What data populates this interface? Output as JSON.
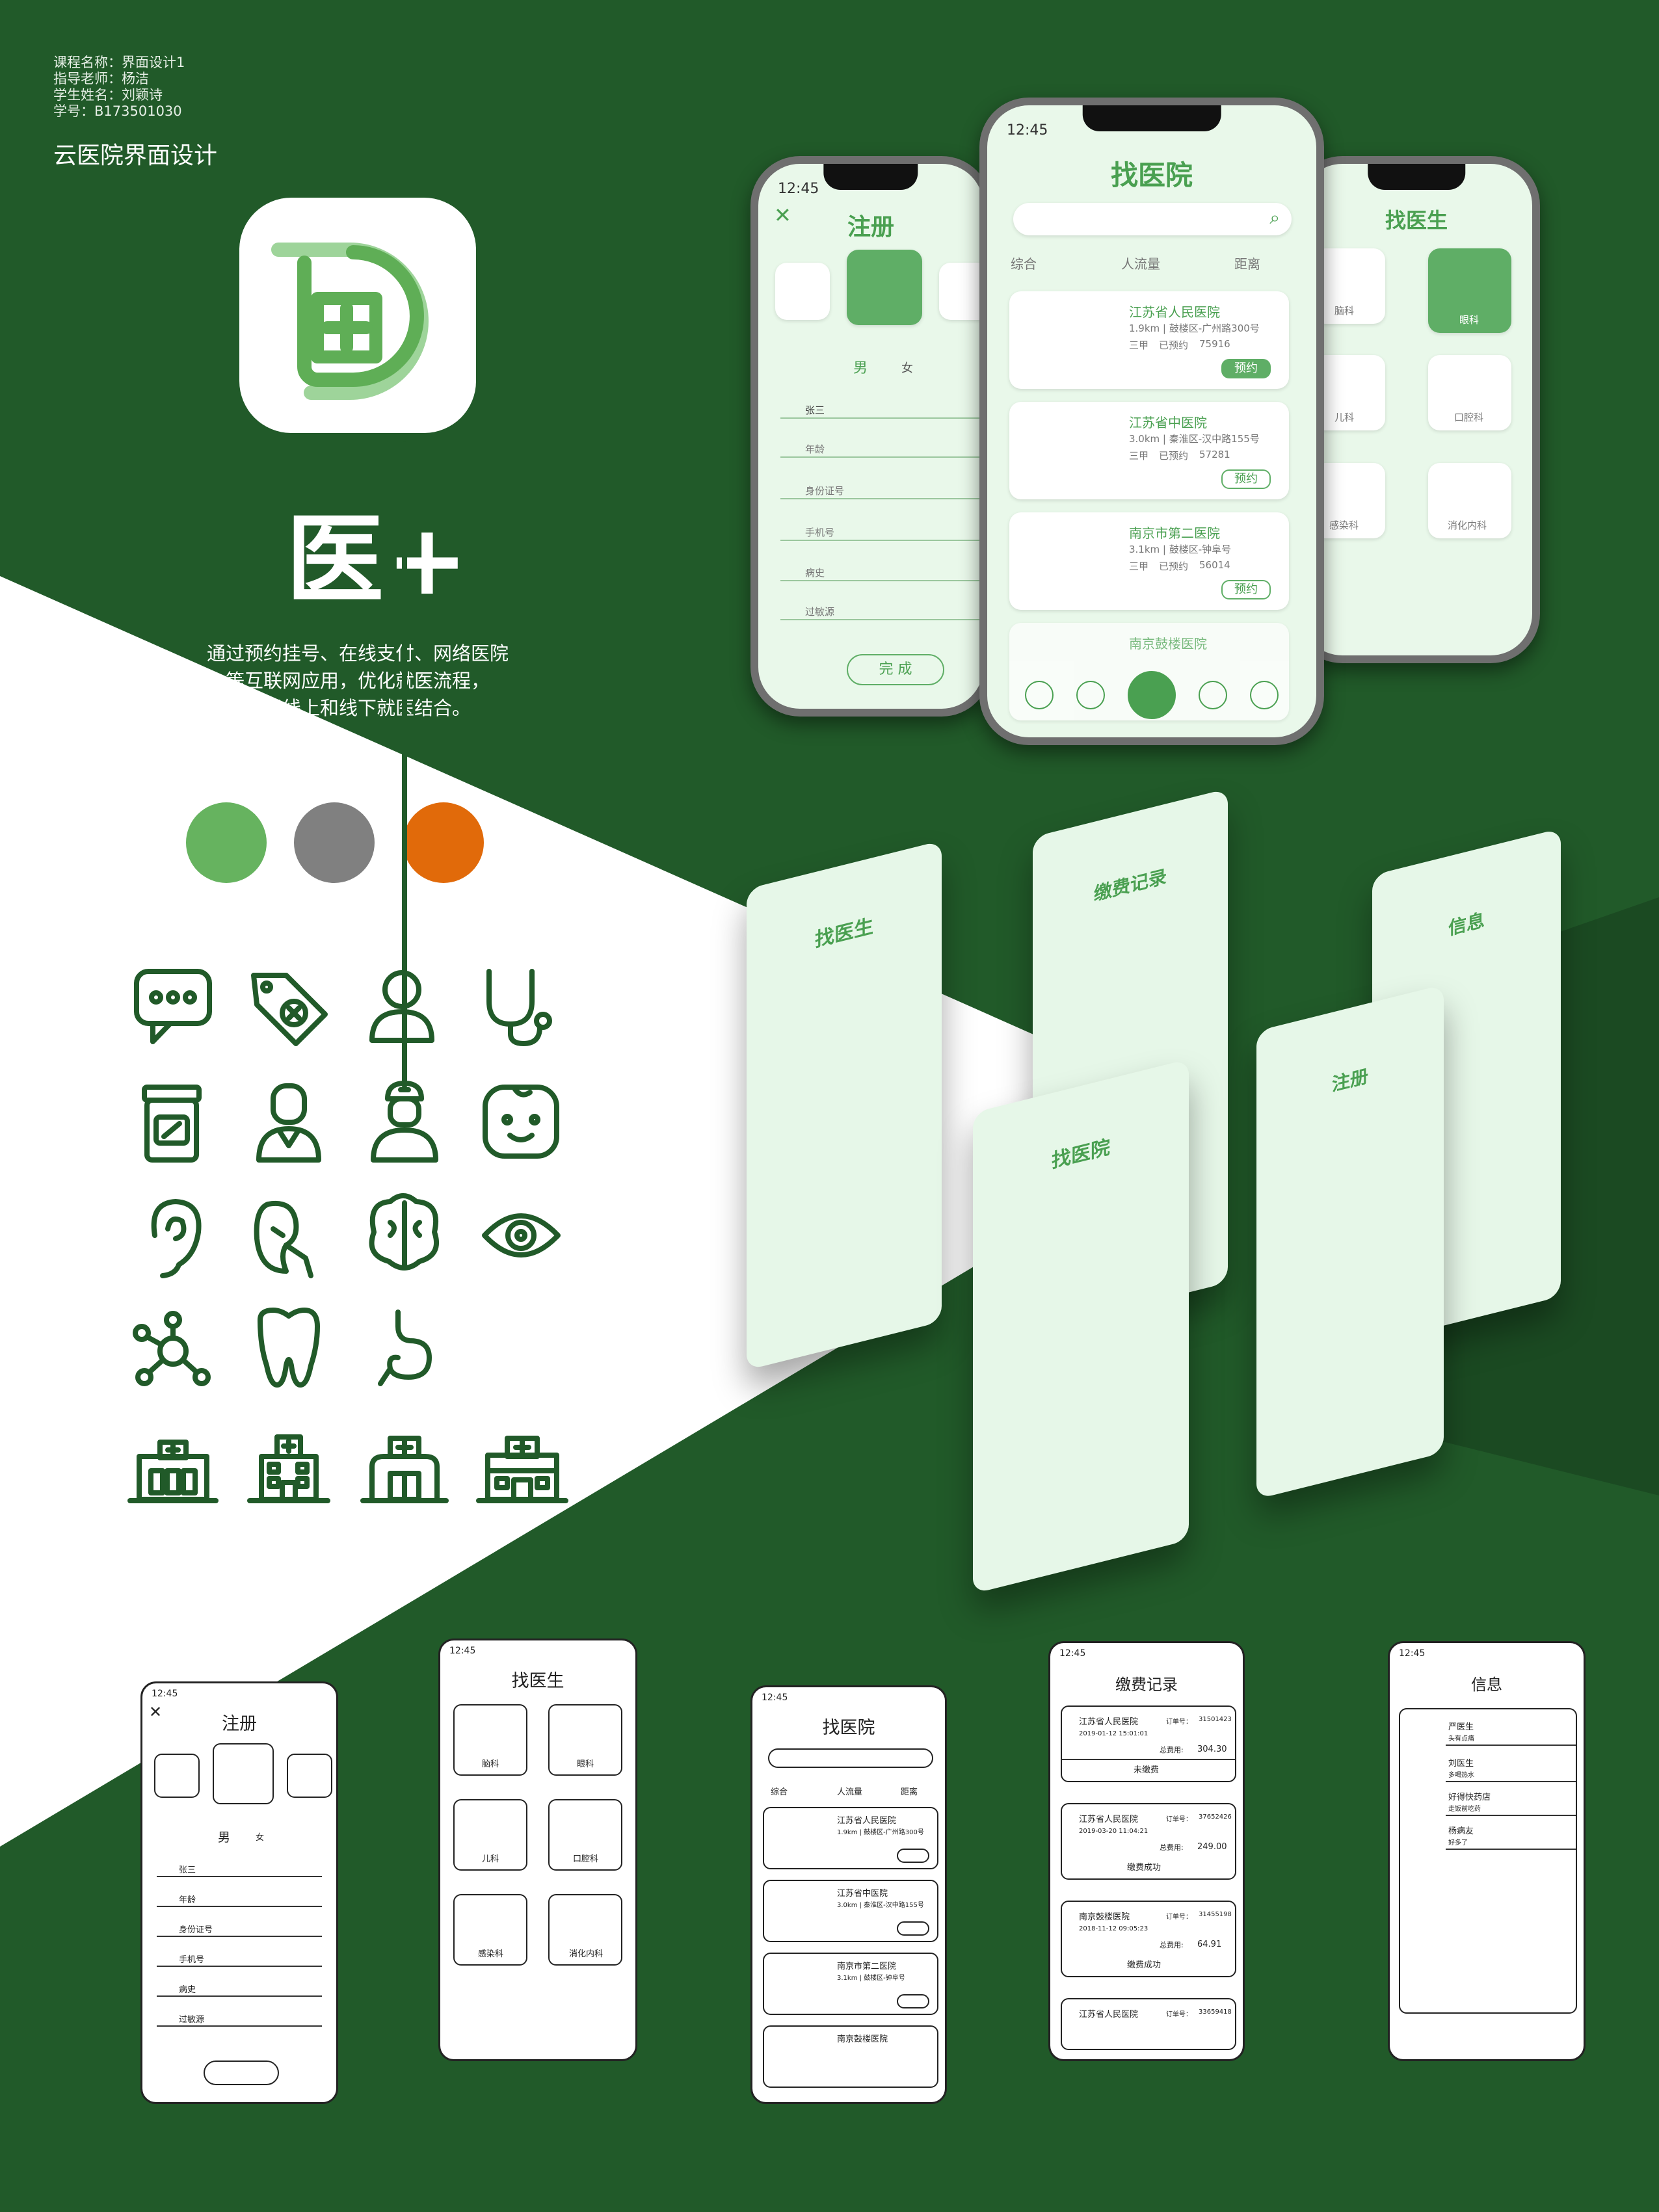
{
  "meta": {
    "course": "课程名称：界面设计1",
    "teacher": "指导老师：杨洁",
    "student": "学生姓名：刘颖诗",
    "student_id": "学号：B173501030"
  },
  "subtitle": "云医院界面设计",
  "brand": "医+",
  "slogan": [
    "通过预约挂号、在线支付、网络医院",
    "等互联网应用，优化就医流程，",
    "实现线上和线下就医结合。"
  ],
  "colors": {
    "bg_dark": "#215a29",
    "green": "#66b35f",
    "grey": "#808080",
    "orange": "#e16a0a",
    "white": "#ffffff"
  },
  "icons": [
    "chat-bubble-icon",
    "medical-tag-icon",
    "user-icon",
    "stethoscope-icon",
    "medicine-bottle-icon",
    "doctor-icon",
    "nurse-icon",
    "baby-face-icon",
    "ear-icon",
    "kidney-icon",
    "brain-icon",
    "eye-icon",
    "molecule-icon",
    "tooth-icon",
    "stomach-icon",
    "hospital-icon",
    "hospital-building-icon",
    "hospital-small-icon",
    "hospital-large-icon"
  ],
  "status_time": "12:45",
  "register": {
    "title": "注册",
    "gender_male": "男",
    "gender_female": "女",
    "fields": [
      "张三",
      "年龄",
      "身份证号",
      "手机号",
      "病史",
      "过敏源"
    ],
    "submit": "完 成"
  },
  "find_hospital": {
    "title": "找医院",
    "filters": [
      "综合",
      "人流量",
      "距离"
    ],
    "book": "预约",
    "hospitals": [
      {
        "name": "江苏省人民医院",
        "info": "1.9km | 鼓楼区-广州路300号",
        "level": "三甲",
        "booked_label": "已预约",
        "booked": "75916"
      },
      {
        "name": "江苏省中医院",
        "info": "3.0km | 秦淮区-汉中路155号",
        "level": "三甲",
        "booked_label": "已预约",
        "booked": "57281"
      },
      {
        "name": "南京市第二医院",
        "info": "3.1km | 鼓楼区-钟阜号",
        "level": "三甲",
        "booked_label": "已预约",
        "booked": "56014"
      },
      {
        "name": "南京鼓楼医院",
        "info": "",
        "level": "",
        "booked_label": "",
        "booked": ""
      }
    ]
  },
  "find_doctor": {
    "title": "找医生",
    "departments": [
      "脑科",
      "眼科",
      "儿科",
      "口腔科",
      "感染科",
      "消化内科"
    ]
  },
  "payment": {
    "title": "缴费记录",
    "records": [
      {
        "hospital": "江苏省人民医院",
        "order_label": "订单号：",
        "order": "31501423",
        "date": "2019-01-12 15:01:01",
        "total_label": "总费用:",
        "total": "304.30",
        "status": "未缴费"
      },
      {
        "hospital": "江苏省人民医院",
        "order_label": "订单号：",
        "order": "37652426",
        "date": "2019-03-20 11:04:21",
        "total_label": "总费用:",
        "total": "249.00",
        "status": "缴费成功"
      },
      {
        "hospital": "南京鼓楼医院",
        "order_label": "订单号：",
        "order": "31455198",
        "date": "2018-11-12 09:05:23",
        "total_label": "总费用:",
        "total": "64.91",
        "status": "缴费成功"
      },
      {
        "hospital": "江苏省人民医院",
        "order_label": "订单号：",
        "order": "33659418",
        "date": "",
        "total_label": "",
        "total": "",
        "status": ""
      }
    ]
  },
  "messages": {
    "title": "信息",
    "items": [
      {
        "name": "严医生",
        "text": "头有点痛"
      },
      {
        "name": "刘医生",
        "text": "多喝热水"
      },
      {
        "name": "好得快药店",
        "text": "走饭前吃药"
      },
      {
        "name": "杨病友",
        "text": "好多了"
      }
    ]
  }
}
